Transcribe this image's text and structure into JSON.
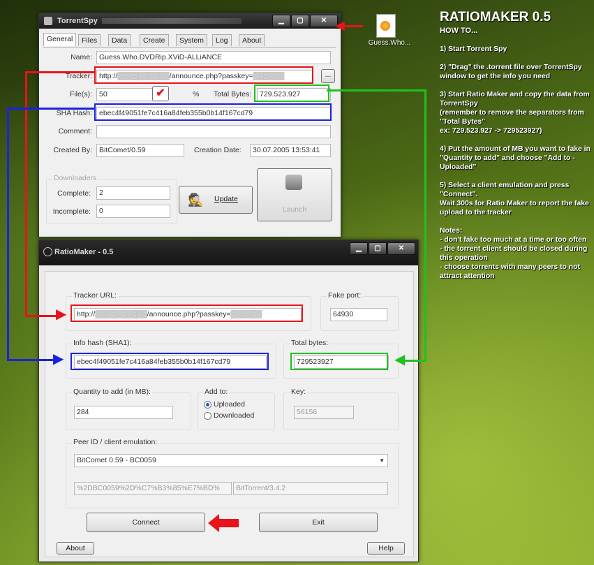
{
  "desktop": {
    "file_icon_label": "Guess.Who..."
  },
  "howto": {
    "title": "RATIOMAKER 0.5",
    "subtitle": "HOW TO...",
    "steps": [
      "1) Start Torrent Spy",
      "2) \"Drag\" the .torrent file over TorrentSpy window to get the info you need",
      "3) Start Ratio Maker and copy the data from TorrentSpy\n(remember to remove the separators from \"Total Bytes\"\nex: 729.523.927  -> 729523927)",
      "4) Put the amount of MB you want to fake in \"Quantity to add\" and choose \"Add to - Uploaded\"",
      "5) Select a client emulation and press \"Connect\".\nWait 300s for Ratio Maker to report the fake upload to the tracker"
    ],
    "notes": "Notes:\n- don't fake too much at a time or too often\n- the torrent client should be closed during this operation\n- choose torrents with many peers to not attract attention"
  },
  "torrentspy": {
    "title": "TorrentSpy",
    "tabs": [
      "General",
      "Files",
      "Data",
      "Create",
      "System",
      "Log",
      "About"
    ],
    "name_label": "Name:",
    "name_value": "Guess.Who.DVDRip.XViD-ALLiANCE",
    "tracker_label": "Tracker:",
    "tracker_value": "http://▒▒▒▒▒▒▒▒▒▒/announce.php?passkey=▒▒▒▒▒▒",
    "files_label": "File(s):",
    "files_value": "50",
    "total_bytes_label": "Total Bytes:",
    "total_bytes_value": "729.523.927",
    "sha_label": "SHA Hash:",
    "sha_value": "ebec4f49051fe7c416a84feb355b0b14f167cd79",
    "comment_label": "Comment:",
    "created_by_label": "Created By:",
    "created_by_value": "BitComet/0.59",
    "creation_date_label": "Creation Date:",
    "creation_date_value": "30.07.2005 13:53:41",
    "downloaders_label": "Downloaders",
    "complete_label": "Complete:",
    "complete_value": "2",
    "incomplete_label": "Incomplete:",
    "incomplete_value": "0",
    "update_label": "Update",
    "launch_label": "Launch",
    "browse_label": "..."
  },
  "ratiomaker": {
    "title": "RatioMaker - 0.5",
    "tracker_url_label": "Tracker URL:",
    "tracker_url_value": "http://▒▒▒▒▒▒▒▒▒▒/announce.php?passkey=▒▒▒▒▒▒",
    "fake_port_label": "Fake port:",
    "fake_port_value": "64930",
    "info_hash_label": "Info hash (SHA1):",
    "info_hash_value": "ebec4f49051fe7c416a84feb355b0b14f167cd79",
    "total_bytes_label": "Total bytes:",
    "total_bytes_value": "729523927",
    "quantity_label": "Quantity to add (in MB):",
    "quantity_value": "284",
    "add_to_label": "Add to:",
    "uploaded_label": "Uploaded",
    "downloaded_label": "Downloaded",
    "key_label": "Key:",
    "key_value": "56156",
    "peer_label": "Peer ID / client emulation:",
    "client_value": "BitComet 0.59 - BC0059",
    "peer_id_value": "%2DBC0059%2D%C7%B3%85%E7%BD%",
    "user_agent_value": "BitTorrent/3.4.2",
    "connect_label": "Connect",
    "exit_label": "Exit",
    "about_label": "About",
    "help_label": "Help"
  }
}
